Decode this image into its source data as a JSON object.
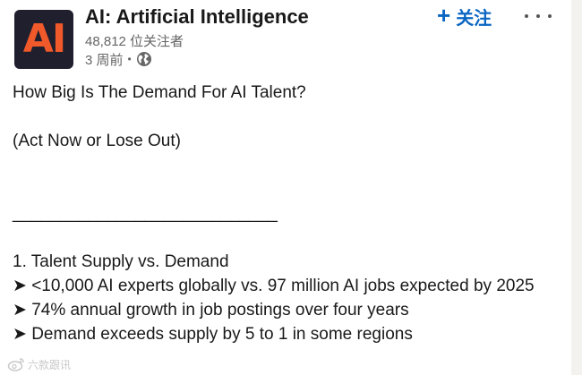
{
  "author": {
    "logo_text": "AI",
    "name": "AI: Artificial Intelligence",
    "followers": "48,812 位关注者",
    "time": "3 周前",
    "visibility_icon": "globe-icon"
  },
  "actions": {
    "follow_icon": "plus-icon",
    "follow_label": "关注",
    "more_icon": "ellipsis-icon"
  },
  "post": {
    "title": "How Big Is The Demand For AI Talent?",
    "subtitle": "(Act Now or Lose Out)",
    "divider": "____________________________",
    "section_heading": "1. Talent Supply vs. Demand",
    "bullets": [
      "➤  <10,000 AI experts globally vs. 97 million AI jobs expected by 2025",
      "➤ 74% annual growth in job postings over four years",
      "➤ Demand exceeds supply by 5 to 1 in some regions"
    ]
  },
  "watermark": {
    "icon": "weibo-icon",
    "text": "六款跟讯"
  },
  "colors": {
    "accent": "#0a66c2",
    "logo_bg": "#201f2e",
    "logo_fg": "#f0592a",
    "text": "#191919",
    "muted": "#666666"
  }
}
